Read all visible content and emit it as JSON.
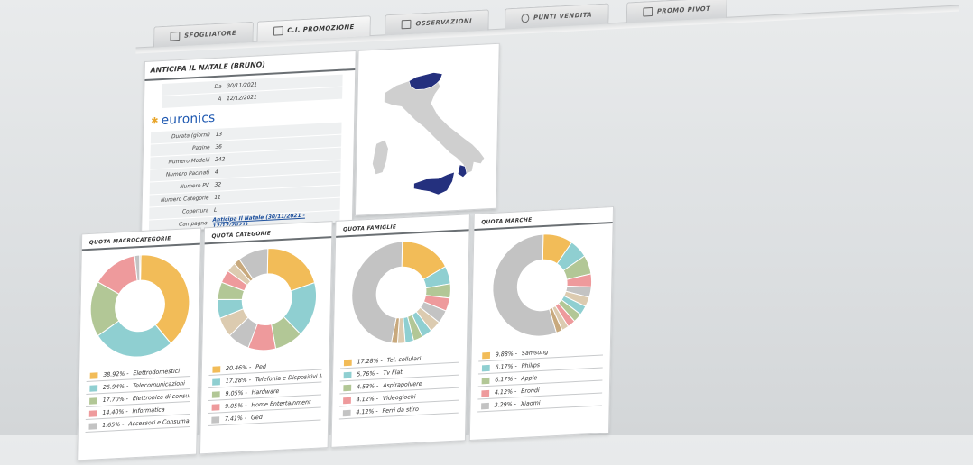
{
  "tabs": [
    {
      "label": "SFOGLIATORE",
      "icon": "book-icon",
      "active": false
    },
    {
      "label": "C.I. PROMOZIONE",
      "icon": "card-icon",
      "active": true
    },
    {
      "label": "OSSERVAZIONI",
      "icon": "notes-icon",
      "active": false
    },
    {
      "label": "PUNTI VENDITA",
      "icon": "user-icon",
      "active": false
    },
    {
      "label": "PROMO PIVOT",
      "icon": "table-icon",
      "active": false
    }
  ],
  "info": {
    "title": "ANTICIPA IL NATALE (BRUNO)",
    "from_label": "Da",
    "from_value": "30/11/2021",
    "to_label": "A",
    "to_value": "12/12/2021",
    "brand": "euronics",
    "fields": [
      {
        "label": "Durata (giorni)",
        "value": "13"
      },
      {
        "label": "Pagine",
        "value": "36"
      },
      {
        "label": "Numero Modelli",
        "value": "242"
      },
      {
        "label": "Numero Pacinati",
        "value": "4"
      },
      {
        "label": "Numero PV",
        "value": "32"
      },
      {
        "label": "Numero Categorie",
        "value": "11"
      },
      {
        "label": "Copertura",
        "value": "L"
      }
    ],
    "campaign_label": "Campagna",
    "campaign_value": "Anticipa Il Natale (30/11/2021 - 12/12/2021)"
  },
  "colors": {
    "yellow": "#f2bc58",
    "teal": "#8fcfd1",
    "green": "#b2c796",
    "pink": "#ee9a9c",
    "grey": "#c3c3c3",
    "beige": "#dccbb0",
    "tan": "#c8a97d",
    "map_blue": "#24307e",
    "map_grey": "#cfcfcf"
  },
  "charts": [
    {
      "title": "QUOTA MACROCATEGORIE",
      "segments": [
        {
          "value": 38.92,
          "color": "#f2bc58"
        },
        {
          "value": 26.94,
          "color": "#8fcfd1"
        },
        {
          "value": 17.7,
          "color": "#b2c796"
        },
        {
          "value": 14.4,
          "color": "#ee9a9c"
        },
        {
          "value": 1.65,
          "color": "#c3c3c3"
        },
        {
          "value": 0.39,
          "color": "#dccbb0"
        }
      ],
      "legend": [
        {
          "pct": "38.92%",
          "label": "Elettrodomestici",
          "color": "#f2bc58"
        },
        {
          "pct": "26.94%",
          "label": "Telecomunicazioni",
          "color": "#8fcfd1"
        },
        {
          "pct": "17.70%",
          "label": "Elettronica di consumo",
          "color": "#b2c796"
        },
        {
          "pct": "14.40%",
          "label": "Informatica",
          "color": "#ee9a9c"
        },
        {
          "pct": "1.65%",
          "label": "Accessori e Consumabili",
          "color": "#c3c3c3"
        }
      ]
    },
    {
      "title": "QUOTA CATEGORIE",
      "segments": [
        {
          "value": 20.46,
          "color": "#f2bc58"
        },
        {
          "value": 17.28,
          "color": "#8fcfd1"
        },
        {
          "value": 9.05,
          "color": "#b2c796"
        },
        {
          "value": 9.05,
          "color": "#ee9a9c"
        },
        {
          "value": 7.41,
          "color": "#c3c3c3"
        },
        {
          "value": 6.5,
          "color": "#dccbb0"
        },
        {
          "value": 6.0,
          "color": "#8fcfd1"
        },
        {
          "value": 5.5,
          "color": "#b2c796"
        },
        {
          "value": 4.0,
          "color": "#ee9a9c"
        },
        {
          "value": 3.0,
          "color": "#dccbb0"
        },
        {
          "value": 2.0,
          "color": "#c8a97d"
        },
        {
          "value": 9.75,
          "color": "#c3c3c3"
        }
      ],
      "legend": [
        {
          "pct": "20.46%",
          "label": "Ped",
          "color": "#f2bc58"
        },
        {
          "pct": "17.28%",
          "label": "Telefonia e Dispositivi Mobili",
          "color": "#8fcfd1"
        },
        {
          "pct": "9.05%",
          "label": "Hardware",
          "color": "#b2c796"
        },
        {
          "pct": "9.05%",
          "label": "Home Entertainment",
          "color": "#ee9a9c"
        },
        {
          "pct": "7.41%",
          "label": "Ged",
          "color": "#c3c3c3"
        }
      ]
    },
    {
      "title": "QUOTA FAMIGLIE",
      "segments": [
        {
          "value": 17.28,
          "color": "#f2bc58"
        },
        {
          "value": 5.76,
          "color": "#8fcfd1"
        },
        {
          "value": 4.53,
          "color": "#b2c796"
        },
        {
          "value": 4.12,
          "color": "#ee9a9c"
        },
        {
          "value": 4.12,
          "color": "#c3c3c3"
        },
        {
          "value": 3.5,
          "color": "#dccbb0"
        },
        {
          "value": 3.3,
          "color": "#8fcfd1"
        },
        {
          "value": 3.0,
          "color": "#b2c796"
        },
        {
          "value": 2.8,
          "color": "#8fcfd1"
        },
        {
          "value": 2.5,
          "color": "#dccbb0"
        },
        {
          "value": 2.0,
          "color": "#c8a97d"
        },
        {
          "value": 47.09,
          "color": "#c3c3c3"
        }
      ],
      "legend": [
        {
          "pct": "17.28%",
          "label": "Tel. cellulari",
          "color": "#f2bc58"
        },
        {
          "pct": "5.76%",
          "label": "Tv Flat",
          "color": "#8fcfd1"
        },
        {
          "pct": "4.53%",
          "label": "Aspirapolvere",
          "color": "#b2c796"
        },
        {
          "pct": "4.12%",
          "label": "Videogiochi",
          "color": "#ee9a9c"
        },
        {
          "pct": "4.12%",
          "label": "Ferri da stiro",
          "color": "#c3c3c3"
        }
      ]
    },
    {
      "title": "QUOTA MARCHE",
      "segments": [
        {
          "value": 9.88,
          "color": "#f2bc58"
        },
        {
          "value": 6.17,
          "color": "#8fcfd1"
        },
        {
          "value": 6.17,
          "color": "#b2c796"
        },
        {
          "value": 4.12,
          "color": "#ee9a9c"
        },
        {
          "value": 3.29,
          "color": "#c3c3c3"
        },
        {
          "value": 3.0,
          "color": "#dccbb0"
        },
        {
          "value": 2.9,
          "color": "#8fcfd1"
        },
        {
          "value": 2.8,
          "color": "#b2c796"
        },
        {
          "value": 2.5,
          "color": "#ee9a9c"
        },
        {
          "value": 2.2,
          "color": "#dccbb0"
        },
        {
          "value": 2.0,
          "color": "#c8a97d"
        },
        {
          "value": 54.97,
          "color": "#c3c3c3"
        }
      ],
      "legend": [
        {
          "pct": "9.88%",
          "label": "Samsung",
          "color": "#f2bc58"
        },
        {
          "pct": "6.17%",
          "label": "Philips",
          "color": "#8fcfd1"
        },
        {
          "pct": "6.17%",
          "label": "Apple",
          "color": "#b2c796"
        },
        {
          "pct": "4.12%",
          "label": "Brondi",
          "color": "#ee9a9c"
        },
        {
          "pct": "3.29%",
          "label": "Xiaomi",
          "color": "#c3c3c3"
        }
      ]
    }
  ]
}
